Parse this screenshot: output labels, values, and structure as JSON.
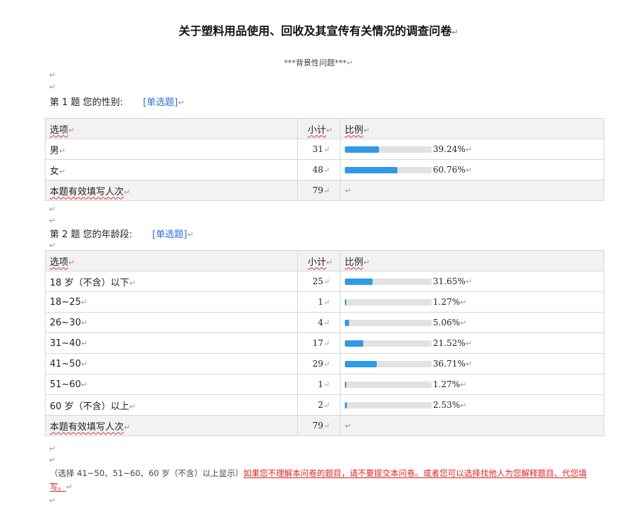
{
  "title": "关于塑料用品使用、回收及其宣传有关情况的调查问卷",
  "subtitle": "***背景性问题***",
  "return_mark": "↵",
  "questions": [
    {
      "label": "第 1 题   您的性别:",
      "type_tag": "[单选题]",
      "header": {
        "option": "选项",
        "count": "小计",
        "ratio": "比例"
      },
      "rows": [
        {
          "option": "男",
          "count": "31",
          "pct_text": "39.24%",
          "pct": 39.24
        },
        {
          "option": "女",
          "count": "48",
          "pct_text": "60.76%",
          "pct": 60.76
        }
      ],
      "total": {
        "label": "本题有效填写人次",
        "count": "79"
      }
    },
    {
      "label": "第 2 题   您的年龄段:",
      "type_tag": "[单选题]",
      "header": {
        "option": "选项",
        "count": "小计",
        "ratio": "比例"
      },
      "rows": [
        {
          "option": "18 岁（不含）以下",
          "count": "25",
          "pct_text": "31.65%",
          "pct": 31.65
        },
        {
          "option": "18~25",
          "count": "1",
          "pct_text": "1.27%",
          "pct": 1.27
        },
        {
          "option": "26~30",
          "count": "4",
          "pct_text": "5.06%",
          "pct": 5.06
        },
        {
          "option": "31~40",
          "count": "17",
          "pct_text": "21.52%",
          "pct": 21.52
        },
        {
          "option": "41~50",
          "count": "29",
          "pct_text": "36.71%",
          "pct": 36.71
        },
        {
          "option": "51~60",
          "count": "1",
          "pct_text": "1.27%",
          "pct": 1.27
        },
        {
          "option": "60 岁（不含）以上",
          "count": "2",
          "pct_text": "2.53%",
          "pct": 2.53
        }
      ],
      "total": {
        "label": "本题有效填写人次",
        "count": "79"
      }
    }
  ],
  "note": {
    "prefix": "（选择 41~50、51~60、60 岁（不含）以上显示）",
    "red": "如果您不理解本问卷的题目，请不要提交本问卷。或者您可以选择找他人为您解释题目、代您填写。"
  },
  "colors": {
    "bar": "#2f9ae8",
    "bar_track": "#e2e2e2",
    "tag": "#2a6fd6",
    "note_red": "#d22"
  }
}
